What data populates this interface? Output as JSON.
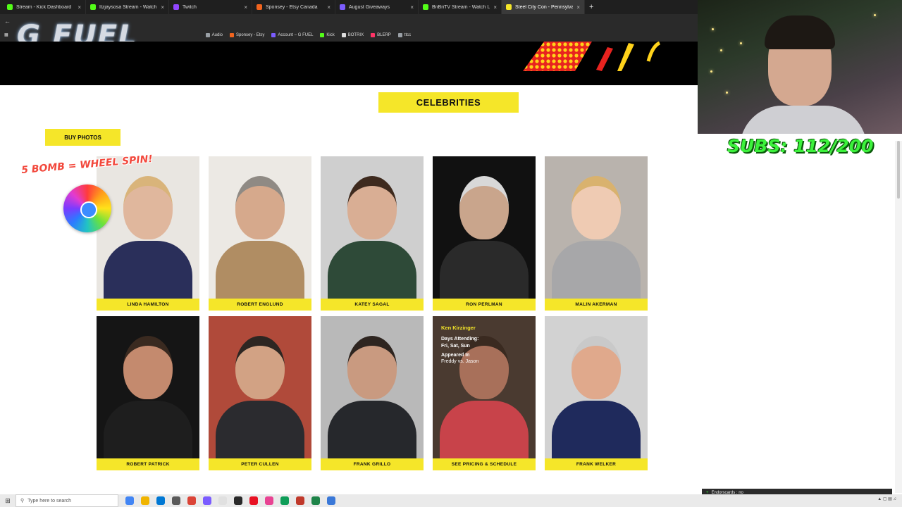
{
  "browser": {
    "tabs": [
      {
        "title": "Stream - Kick Dashboard",
        "color": "#53fc18"
      },
      {
        "title": "Itzjaysosa Stream - Watch Live",
        "color": "#53fc18"
      },
      {
        "title": "Twitch",
        "color": "#9146ff"
      },
      {
        "title": "Sponsey - Etsy Canada",
        "color": "#f1641e"
      },
      {
        "title": "August Giveaways",
        "color": "#7b5cff"
      },
      {
        "title": "BnBriTV Stream - Watch Live o",
        "color": "#53fc18"
      },
      {
        "title": "Steel City Con - Pennsylvania's",
        "color": "#f5e629"
      }
    ],
    "new_tab": "+",
    "close_glyph": "×",
    "bookmarks": [
      {
        "label": "Audio",
        "color": "#9aa0a6"
      },
      {
        "label": "Sponsey - Etsy",
        "color": "#f1641e"
      },
      {
        "label": "Account – G FUEL",
        "color": "#7b5cff"
      },
      {
        "label": "Kick",
        "color": "#53fc18"
      },
      {
        "label": "BOTRIX",
        "color": "#dddddd"
      },
      {
        "label": "BLERP",
        "color": "#ff3366"
      },
      {
        "label": "ttcc",
        "color": "#9aa0a6"
      }
    ]
  },
  "overlay": {
    "gfuel_logo": "G FUEL",
    "bomb_text": "5 BOMB = WHEEL SPIN!",
    "subs": "SUBS: 112/200",
    "notification": "Endorscards : no"
  },
  "page": {
    "section_title": "CELEBRITIES",
    "buy_photos": "BUY PHOTOS",
    "celebrities": [
      {
        "name": "LINDA HAMILTON",
        "bg": "#e9e6e1",
        "skin": "#e0b79d",
        "hair": "#d9b47a",
        "clothes": "#2a2f5a"
      },
      {
        "name": "ROBERT ENGLUND",
        "bg": "#ece9e4",
        "skin": "#d6a98c",
        "hair": "#8f8a84",
        "clothes": "#b08d63"
      },
      {
        "name": "KATEY SAGAL",
        "bg": "#cfcfcf",
        "skin": "#d9ae94",
        "hair": "#3e2a1e",
        "clothes": "#2e4a38"
      },
      {
        "name": "RON PERLMAN",
        "bg": "#111111",
        "skin": "#c9a58c",
        "hair": "#d8d8d8",
        "clothes": "#2a2a2a"
      },
      {
        "name": "MALIN AKERMAN",
        "bg": "#b9b3ad",
        "skin": "#efcbb3",
        "hair": "#d9b26e",
        "clothes": "#a7a7a9"
      },
      {
        "name": "ROBERT PATRICK",
        "bg": "#151515",
        "skin": "#c48a6e",
        "hair": "#3a2a20",
        "clothes": "#1e1e1e"
      },
      {
        "name": "PETER CULLEN",
        "bg": "#b04a3a",
        "skin": "#d2a284",
        "hair": "#2d2622",
        "clothes": "#2b2b2f"
      },
      {
        "name": "FRANK GRILLO",
        "bg": "#b9b9b9",
        "skin": "#c99a80",
        "hair": "#2e2520",
        "clothes": "#26282c"
      },
      {
        "name": "SEE PRICING & SCHEDULE",
        "bg": "#4a3a30",
        "skin": "#a8705a",
        "hair": "#3a2a20",
        "clothes": "#c8434a"
      },
      {
        "name": "FRANK WELKER",
        "bg": "#d2d2d2",
        "skin": "#e0a98c",
        "hair": "#c9c9c9",
        "clothes": "#1f2a5c"
      }
    ],
    "hover_card": {
      "name": "Ken Kirzinger",
      "days_label": "Days Attending:",
      "days": "Fri, Sat, Sun",
      "appeared_label": "Appeared In",
      "appeared": "Freddy vs. Jason"
    }
  },
  "taskbar": {
    "search_placeholder": "Type here to search",
    "apps": [
      "#4285f4",
      "#f0b400",
      "#0078d4",
      "#5a5a5a",
      "#db4437",
      "#7b5cff",
      "#e0e0e0",
      "#2a2a2a",
      "#e81123",
      "#e84393",
      "#0f9d58",
      "#c0392b",
      "#1e8449",
      "#3a78d8"
    ]
  }
}
